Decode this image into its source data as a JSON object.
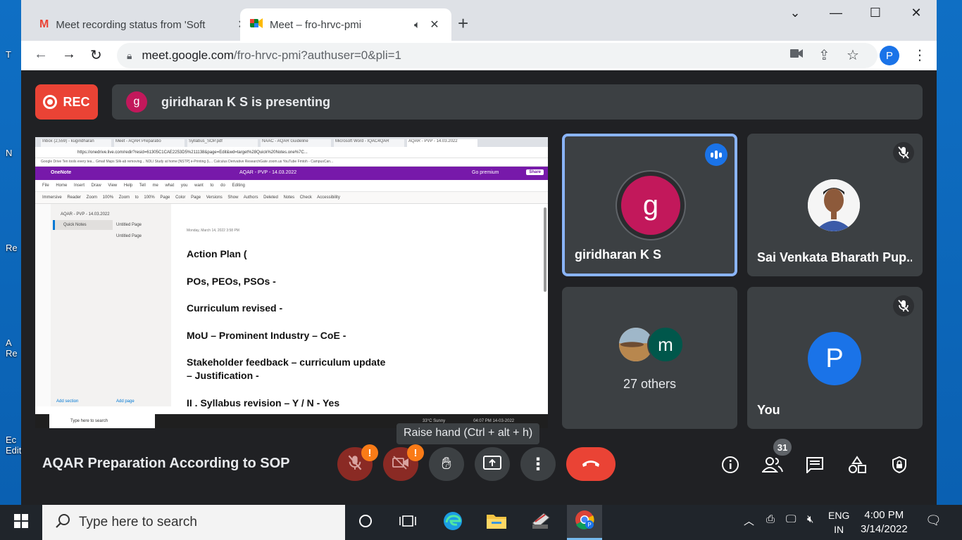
{
  "browser": {
    "tabs": [
      {
        "title": "Meet recording status from 'Soft",
        "active": false
      },
      {
        "title": "Meet – fro-hrvc-pmi",
        "active": true
      }
    ],
    "url_host": "meet.google.com",
    "url_path": "/fro-hrvc-pmi?authuser=0&pli=1",
    "profile_initial": "P"
  },
  "meet": {
    "rec_label": "REC",
    "presenter_initial": "g",
    "presenting_text": "giridharan K S is presenting",
    "shared_screen": {
      "tabs": [
        "Inbox (2,559) - kugiridharan",
        "Meet - AQAR Preparatio",
        "Syllabus_SOP.pdf",
        "NAAC - AQAR Guideline",
        "Microsoft Word - IQAC4QAR",
        "AQAR - PVP - 14.03.2022"
      ],
      "url": "https://onedrive.live.com/redir?resid=61305C1CAE2253D5%211138&page=Edit&wd=target%28Quick%20Notes.one%7C...",
      "bookmarks": "Google Drive   Ten tools every tea...   Gmail   Maps   Silk-ab removing...   NDLI Study at home   [NSTP] e-Printing (L...   Calculus Derivative   ResearchGate   zoom.us   YouTube   Fmtoh - CampusCan...",
      "app_name": "OneNote",
      "doc_title": "AQAR - PVP - 14.03.2022",
      "premium": "Go premium",
      "share": "Share",
      "menu": "File  Home  Insert  Draw  View  Help  Tell me what you want to do  Editing",
      "ribbon": "Immersive Reader  Zoom 100%  Zoom to 100%  Page Color  Page Versions  Show Authors  Deleted Notes  Check Accessibility",
      "notebook": "AQAR - PVP - 14.03.2022",
      "section": "Quick Notes",
      "pages": [
        "Untitled Page",
        "Untitled Page"
      ],
      "add_section": "Add section",
      "add_page": "Add page",
      "date": "Monday, March 14, 2022    3:58 PM",
      "lines": [
        "Action Plan (",
        "POs, PEOs, PSOs -",
        "Curriculum revised -",
        "MoU – Prominent Industry – CoE -",
        "Stakeholder feedback – curriculum update",
        "– Justification -",
        "II . Syllabus revision – Y / N - Yes"
      ],
      "task_search": "Type here to search",
      "task_weather": "33°C  Sunny",
      "task_clock": "04:07 PM  14-03-2022"
    },
    "participants": [
      {
        "name": "giridharan K S",
        "initial": "g",
        "active": true
      },
      {
        "name": "Sai Venkata Bharath Pup...",
        "muted": true
      },
      {
        "name": "27 others",
        "others_initial": "m"
      },
      {
        "name": "You",
        "initial": "P",
        "muted": true
      }
    ],
    "tooltip": "Raise hand (Ctrl + alt + h)",
    "meeting_title": "AQAR Preparation According to SOP",
    "participant_count": "31",
    "controls": [
      "mic-off",
      "camera-off",
      "raise-hand",
      "present",
      "more",
      "leave-call"
    ],
    "right_controls": [
      "info",
      "people",
      "chat",
      "activities",
      "host-controls"
    ]
  },
  "taskbar": {
    "search_placeholder": "Type here to search",
    "lang_top": "ENG",
    "lang_bottom": "IN",
    "time": "4:00 PM",
    "date": "3/14/2022"
  },
  "colors": {
    "rec": "#ea4335",
    "leave": "#ea4335",
    "accent": "#8ab4f8",
    "giri_avatar": "#c2185b",
    "you_avatar": "#1a73e8",
    "others_avatar": "#00574b"
  }
}
